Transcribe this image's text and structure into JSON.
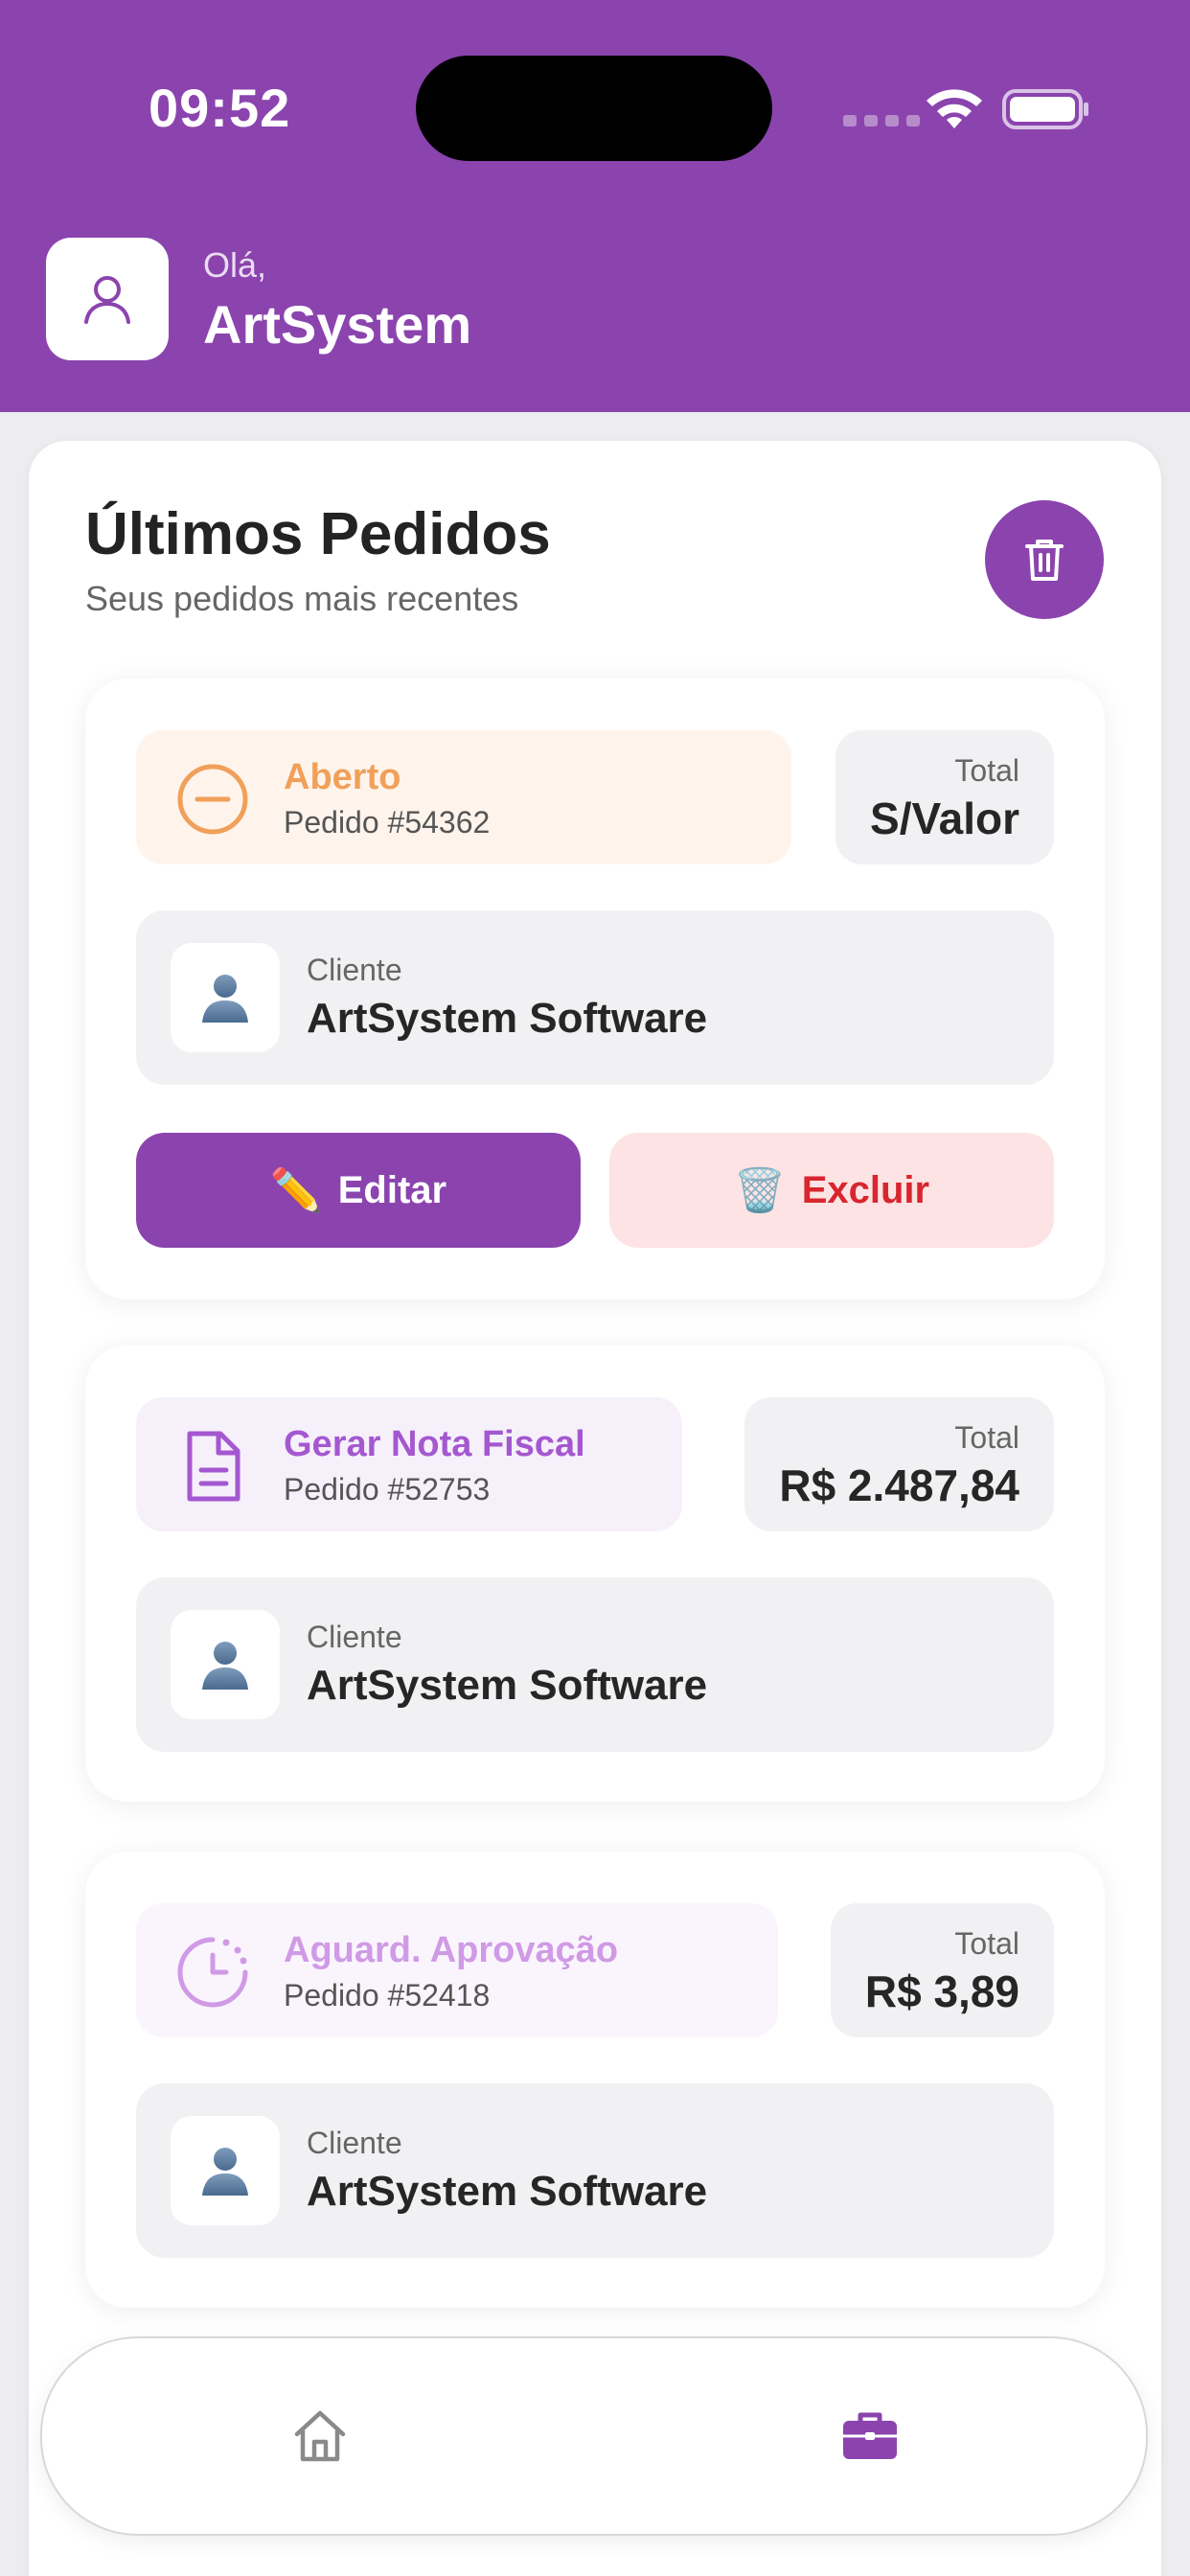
{
  "status_bar": {
    "time": "09:52"
  },
  "header": {
    "greeting": "Olá,",
    "user_name": "ArtSystem"
  },
  "orders_section": {
    "title": "Últimos Pedidos",
    "subtitle": "Seus pedidos mais recentes"
  },
  "orders": [
    {
      "status": "Aberto",
      "status_color": "#f0a05a",
      "status_bg": "#fff4ec",
      "status_icon": "minus-circle-icon",
      "order_number": "Pedido #54362",
      "total_label": "Total",
      "total_value": "S/Valor",
      "client_label": "Cliente",
      "client_name": "ArtSystem Software",
      "edit_label": "Editar",
      "delete_label": "Excluir"
    },
    {
      "status": "Gerar Nota Fiscal",
      "status_color": "#a458d0",
      "status_bg": "#f6f0fb",
      "status_icon": "document-icon",
      "order_number": "Pedido #52753",
      "total_label": "Total",
      "total_value": "R$ 2.487,84",
      "client_label": "Cliente",
      "client_name": "ArtSystem Software"
    },
    {
      "status": "Aguard. Aprovação",
      "status_color": "#d09ae6",
      "status_bg": "#faf5fd",
      "status_icon": "clock-icon",
      "order_number": "Pedido #52418",
      "total_label": "Total",
      "total_value": "R$ 3,89",
      "client_label": "Cliente",
      "client_name": "ArtSystem Software"
    }
  ],
  "bottom_nav": {
    "items": [
      {
        "icon": "home-icon",
        "active": false
      },
      {
        "icon": "briefcase-icon",
        "active": true
      }
    ]
  },
  "colors": {
    "brand": "#8b44ae",
    "danger": "#d7262e",
    "danger_bg": "#fde3e4"
  }
}
